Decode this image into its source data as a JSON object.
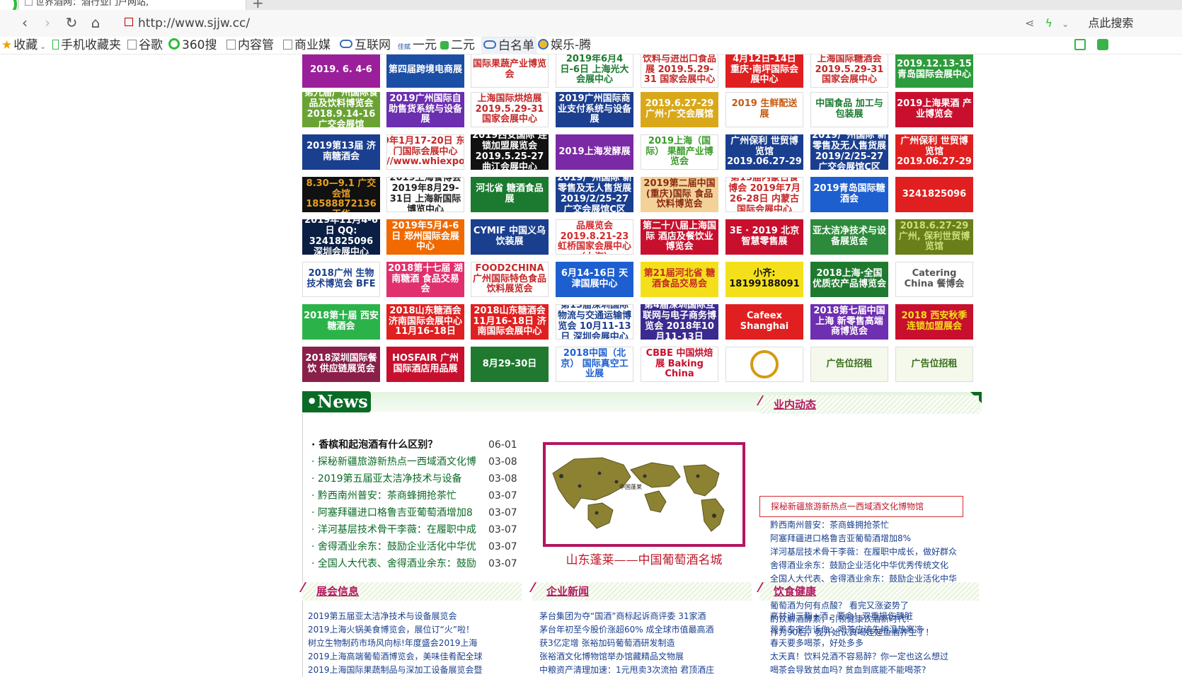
{
  "browser": {
    "tab_title": "世界酒网：酒行业门户网站,",
    "url": "http://www.sjjw.cc/",
    "search_label": "点此搜索"
  },
  "bookmarks": [
    {
      "label": "收藏",
      "icon": "star-icon"
    },
    {
      "label": "手机收藏夹",
      "icon": "phone-icon"
    },
    {
      "label": "谷歌",
      "icon": "doc-icon"
    },
    {
      "label": "360搜",
      "icon": "360-icon"
    },
    {
      "label": "内容管",
      "icon": "doc-icon"
    },
    {
      "label": "商业媒",
      "icon": "doc-icon"
    },
    {
      "label": "互联网",
      "icon": "cloud-icon"
    },
    {
      "label": "一元",
      "icon": "site-icon"
    },
    {
      "label": "二元",
      "icon": "green-icon"
    },
    {
      "label": "白名单",
      "icon": "cloud-icon"
    },
    {
      "label": "娱乐-腾",
      "icon": "earth-icon"
    }
  ],
  "ads": {
    "row0": [
      "2019. 6. 4-6",
      "第四届跨境电商展",
      "国际果蔬产业博览会",
      "2019年6月4日-6日 上海光大会展中心",
      "饮料与进出口食品展 2019.5.29-31 国家会展中心",
      "4月12日-14日 重庆·南坪国际会展中心",
      "上海国际糖酒会 2019.5.29-31 国家会展中心",
      "2019.12.13-15 青岛国际会展中心"
    ],
    "row1": [
      "第九届广州国际食品及饮料博览会 2018.9.14-16 广交会展馆",
      "2019广州国际自助售货系统与设备展",
      "上海国际烘焙展 2019.5.29-31 国家会展中心",
      "2019广州国际商业支付系统与设备展",
      "2019.6.27-29 广州·广交会展馆",
      "2019 生鲜配送展",
      "中国食品 加工与包装展",
      "2019上海果酒 产业博览会"
    ],
    "row2": [
      "2019第13届 济南糖酒会",
      "2019年1月17-20日 东莞·虎门国际会展中心 http://www.whiexpo.com",
      "2019西安国际 连锁加盟展览会 2019.5.25-27 曲江会展中心",
      "2019上海发酵展",
      "2019上海（国际） 果醋产业博览会",
      "广州保利 世贸博览馆 2019.06.27-29",
      "2019广州国际 新零售及无人售货展 2019/2/25-27 广交会展馆C区",
      "广州保利 世贸博览馆 2019.06.27-29"
    ],
    "row3": [
      "2019广州糖酒会 8.30—9.1 广交会馆 18588872136王华",
      "2019上海餐博会 2019年8月29-31日 上海新国际博览中心",
      "河北省 糖酒食品展",
      "2019广州国际 新零售及无人售货展 2019/2/25-27 广交会展馆C区",
      "2019第二届中国(重庆)国际 食品饮料博览会",
      "第15届内蒙古食博会 2019年7月26-28日 内蒙古国际会展中心",
      "2019青岛国际糖酒会",
      "3241825096"
    ],
    "row4": [
      "2019年11月4-6日 QQ: 3241825096 深圳会展中心",
      "2019年5月4-6日 郑州国际会展中心",
      "CYMIF 中国义乌饮装展",
      "自有品牌及高端食品展览会 2019.8.21-23 虹桥国家会展中心（上海）",
      "第二十八届上海国际 酒店及餐饮业博览会",
      "3E · 2019 北京智慧零售展",
      "亚太洁净技术与设备展览会",
      "2018.6.27-29 广州, 保利世贸博览馆"
    ],
    "row5": [
      "2018广州 生物技术博览会 BFE",
      "2018第十七届 湖南糖酒 食品交易会",
      "FOOD2CHINA 广州国际特色食品 饮料展览会",
      "6月14-16日 天津国展中心",
      "第21届河北省 糖酒食品交易会",
      "小齐: 18199188091",
      "2018上海·全国 优质农产品博览会",
      "Catering China 餐博会"
    ],
    "row6": [
      "2018第十届 西安糖酒会",
      "2018山东糖酒会 济南国际会展中心 11月16-18日",
      "2018山东糖酒会 11月16-18日 济南国际会展中心",
      "第13届深圳国际 物流与交通运输博览会 10月11-13日 深圳会展中心",
      "第4届深圳国际互联网与电子商务博览会 2018年10月11-13日",
      "Cafeex Shanghai",
      "2018第七届中国上海 新零售高端商博览会",
      "2018 西安秋季 连锁加盟展会"
    ],
    "row7": [
      "2018深圳国际餐饮 供应链展览会",
      "HOSFAIR 广州国际酒店用品展",
      "8月29-30日",
      "2018中国（北京） 国际真空工业展",
      "CBBE 中国烘焙展 Baking China",
      "",
      "广告位招租",
      "广告位招租"
    ]
  },
  "news": {
    "header": "News",
    "items": [
      {
        "title": "香槟和起泡酒有什么区别？",
        "date": "06-01"
      },
      {
        "title": "探秘新疆旅游新热点一西域酒文化博",
        "date": "03-08"
      },
      {
        "title": "2019第五届亚太洁净技术与设备",
        "date": "03-08"
      },
      {
        "title": "黔西南州普安：茶商蜂拥抢茶忙",
        "date": "03-07"
      },
      {
        "title": "阿塞拜疆进口格鲁吉亚葡萄酒增加8",
        "date": "03-07"
      },
      {
        "title": "洋河基层技术骨干李薇：在履职中成",
        "date": "03-07"
      },
      {
        "title": "舍得酒业余东：鼓励企业活化中华优",
        "date": "03-07"
      },
      {
        "title": "全国人大代表、舍得酒业余东：鼓励",
        "date": "03-07"
      }
    ],
    "map_label": "中国蓬莱",
    "map_caption": "山东蓬莱——中国葡萄酒名城"
  },
  "industry": {
    "title": "业内动态",
    "highlight": "探秘新疆旅游新热点一西域酒文化博物馆",
    "items": [
      "黔西南州普安：茶商蜂拥抢茶忙",
      "阿塞拜疆进口格鲁吉亚葡萄酒增加8%",
      "洋河基层技术骨干李薇：在履职中成长，做好群众",
      "舍得酒业余东：鼓励企业活化中华优秀传统文化",
      "全国人大代表、舍得酒业余东：鼓励企业活化中华",
      "罗甸林下种茶保青山添银山",
      "葡萄酒为何有点酸？ 看完又涨姿势了",
      "酌饮解酒酵素，引领健康饮酒新时代！",
      "作为90后，我开始认真喝娃娃鱼酒养生了！"
    ]
  },
  "exhibition": {
    "title": "展会信息",
    "items": [
      "2019第五届亚太洁净技术与设备展览会",
      "2019上海火锅美食博览会，展位订“火”啦！",
      "树立生物制药市场风向标!年度盛会2019上海",
      "2019上海高端葡萄酒博览会，美味佳肴配全球",
      "2019上海国际果蔬制品与深加工设备展览会暨"
    ]
  },
  "enterprise": {
    "title": "企业新闻",
    "items": [
      "茅台集团为夺“国酒”商标起诉商评委 31家酒",
      "茅台年初至今股价涨超60% 成全球市值最高酒",
      "获3亿定增 张裕加码葡萄酒研发制造",
      "张裕酒文化博物馆举办馆藏精品文物展",
      "中粮资产清理加速：1元甩卖3次流拍 君顶酒庄"
    ]
  },
  "health": {
    "title": "饮食健康",
    "items": [
      "高甘油三酯+酒，要命！双重损伤胰脏",
      "营养专家告诉你：喝茶应该先辨温热寒凉",
      "春天要多喝茶，好处多多",
      "太天真！饮料兑酒不容易醉？你一定也这么想过",
      "喝茶会导致贫血吗? 贫血到底能不能喝茶?"
    ]
  },
  "colors": {
    "brand_green": "#0a6b25",
    "accent_magenta": "#b3165f",
    "link_blue": "#1a3f8f",
    "highlight_red": "#c0182a"
  }
}
